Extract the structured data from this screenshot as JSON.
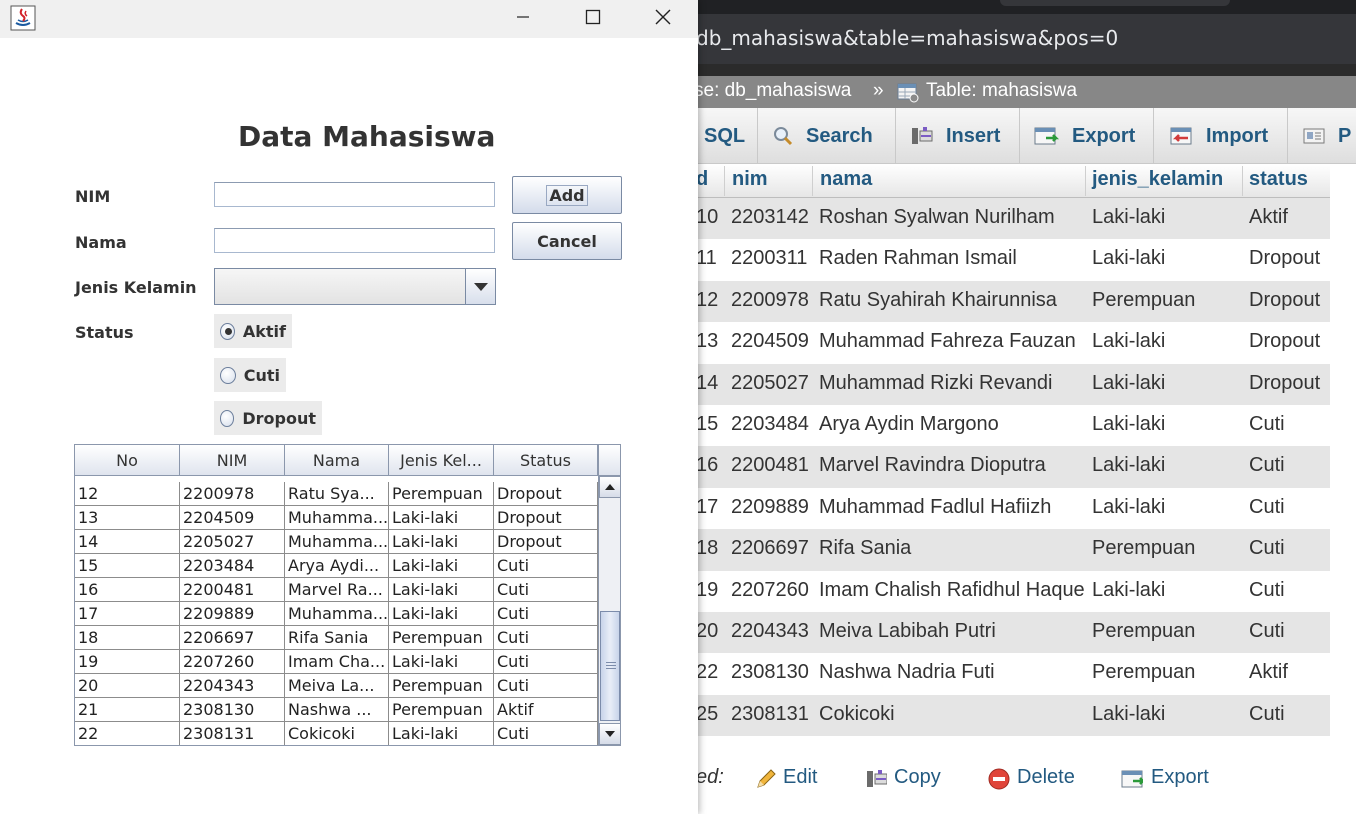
{
  "browser": {
    "url": "db_mahasiswa&table=mahasiswa&pos=0",
    "breadcrumb_db": "se: db_mahasiswa",
    "breadcrumb_sep": "»",
    "breadcrumb_table": "Table: mahasiswa",
    "tabs": [
      {
        "label": "SQL",
        "icon": "sql-icon"
      },
      {
        "label": "Search",
        "icon": "search-icon"
      },
      {
        "label": "Insert",
        "icon": "insert-icon"
      },
      {
        "label": "Export",
        "icon": "export-icon"
      },
      {
        "label": "Import",
        "icon": "import-icon"
      },
      {
        "label": "P",
        "icon": "privileges-icon"
      }
    ],
    "columns": [
      "d",
      "nim",
      "nama",
      "jenis_kelamin",
      "status"
    ],
    "rows": [
      [
        "10",
        "2203142",
        "Roshan Syalwan Nurilham",
        "Laki-laki",
        "Aktif"
      ],
      [
        "11",
        "2200311",
        "Raden Rahman Ismail",
        "Laki-laki",
        "Dropout"
      ],
      [
        "12",
        "2200978",
        "Ratu Syahirah Khairunnisa",
        "Perempuan",
        "Dropout"
      ],
      [
        "13",
        "2204509",
        "Muhammad Fahreza Fauzan",
        "Laki-laki",
        "Dropout"
      ],
      [
        "14",
        "2205027",
        "Muhammad Rizki Revandi",
        "Laki-laki",
        "Dropout"
      ],
      [
        "15",
        "2203484",
        "Arya Aydin Margono",
        "Laki-laki",
        "Cuti"
      ],
      [
        "16",
        "2200481",
        "Marvel Ravindra Dioputra",
        "Laki-laki",
        "Cuti"
      ],
      [
        "17",
        "2209889",
        "Muhammad Fadlul Hafiizh",
        "Laki-laki",
        "Cuti"
      ],
      [
        "18",
        "2206697",
        "Rifa Sania",
        "Perempuan",
        "Cuti"
      ],
      [
        "19",
        "2207260",
        "Imam Chalish Rafidhul Haque",
        "Laki-laki",
        "Cuti"
      ],
      [
        "20",
        "2204343",
        "Meiva Labibah Putri",
        "Perempuan",
        "Cuti"
      ],
      [
        "22",
        "2308130",
        "Nashwa Nadria Futi",
        "Perempuan",
        "Aktif"
      ],
      [
        "25",
        "2308131",
        "Cokicoki",
        "Laki-laki",
        "Cuti"
      ]
    ],
    "with_selected": "ed:",
    "actions": [
      {
        "label": "Edit",
        "icon": "pencil-icon"
      },
      {
        "label": "Copy",
        "icon": "copy-icon"
      },
      {
        "label": "Delete",
        "icon": "delete-icon"
      },
      {
        "label": "Export",
        "icon": "export-icon"
      }
    ]
  },
  "dialog": {
    "app_icon": "java-icon",
    "title": "Data Mahasiswa",
    "labels": {
      "nim": "NIM",
      "nama": "Nama",
      "jenis_kelamin": "Jenis Kelamin",
      "status": "Status"
    },
    "nim_value": "",
    "nama_value": "",
    "jenis_kelamin_value": "",
    "buttons": {
      "add": "Add",
      "cancel": "Cancel"
    },
    "status_options": [
      {
        "label": "Aktif",
        "selected": true
      },
      {
        "label": "Cuti",
        "selected": false
      },
      {
        "label": "Dropout",
        "selected": false
      }
    ],
    "table": {
      "headers": [
        "No",
        "NIM",
        "Nama",
        "Jenis Kel...",
        "Status"
      ],
      "rows": [
        [
          "12",
          "2200978",
          "Ratu Sya...",
          "Perempuan",
          "Dropout"
        ],
        [
          "13",
          "2204509",
          "Muhamma...",
          "Laki-laki",
          "Dropout"
        ],
        [
          "14",
          "2205027",
          "Muhamma...",
          "Laki-laki",
          "Dropout"
        ],
        [
          "15",
          "2203484",
          "Arya Aydi...",
          "Laki-laki",
          "Cuti"
        ],
        [
          "16",
          "2200481",
          "Marvel Ra...",
          "Laki-laki",
          "Cuti"
        ],
        [
          "17",
          "2209889",
          "Muhamma...",
          "Laki-laki",
          "Cuti"
        ],
        [
          "18",
          "2206697",
          "Rifa Sania",
          "Perempuan",
          "Cuti"
        ],
        [
          "19",
          "2207260",
          "Imam Cha...",
          "Laki-laki",
          "Cuti"
        ],
        [
          "20",
          "2204343",
          "Meiva La...",
          "Perempuan",
          "Cuti"
        ],
        [
          "21",
          "2308130",
          "Nashwa ...",
          "Perempuan",
          "Aktif"
        ],
        [
          "22",
          "2308131",
          "Cokicoki",
          "Laki-laki",
          "Cuti"
        ]
      ]
    }
  }
}
